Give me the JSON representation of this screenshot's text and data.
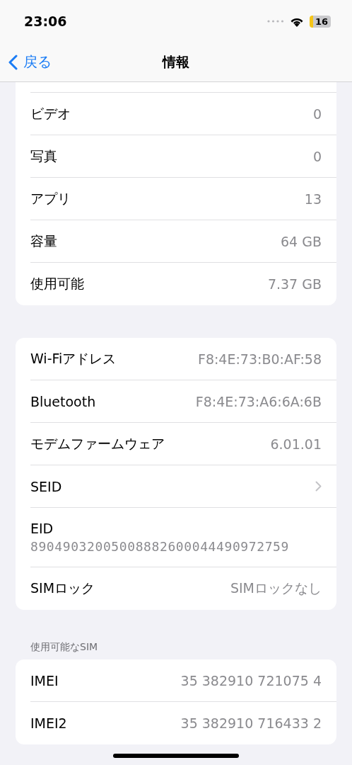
{
  "status_bar": {
    "time": "23:06",
    "battery": "16"
  },
  "nav": {
    "back": "戻る",
    "title": "情報"
  },
  "groups": [
    {
      "cut_top": true,
      "rows": [
        {
          "kind": "value",
          "label": "ビデオ",
          "value": "0"
        },
        {
          "kind": "value",
          "label": "写真",
          "value": "0"
        },
        {
          "kind": "value",
          "label": "アプリ",
          "value": "13"
        },
        {
          "kind": "value",
          "label": "容量",
          "value": "64 GB"
        },
        {
          "kind": "value",
          "label": "使用可能",
          "value": "7.37 GB"
        }
      ]
    },
    {
      "cut_top": false,
      "rows": [
        {
          "kind": "value",
          "label": "Wi-Fiアドレス",
          "value": "F8:4E:73:B0:AF:58"
        },
        {
          "kind": "value",
          "label": "Bluetooth",
          "value": "F8:4E:73:A6:6A:6B"
        },
        {
          "kind": "value",
          "label": "モデムファームウェア",
          "value": "6.01.01"
        },
        {
          "kind": "chevron",
          "label": "SEID"
        },
        {
          "kind": "stacked",
          "label": "EID",
          "value": "89049032005008882600044490972759"
        },
        {
          "kind": "value",
          "label": "SIMロック",
          "value": "SIMロックなし"
        }
      ]
    },
    {
      "cut_top": false,
      "header": "使用可能なSIM",
      "rows": [
        {
          "kind": "value",
          "label": "IMEI",
          "value": "35 382910 721075 4"
        },
        {
          "kind": "value",
          "label": "IMEI2",
          "value": "35 382910 716433 2"
        }
      ]
    }
  ]
}
